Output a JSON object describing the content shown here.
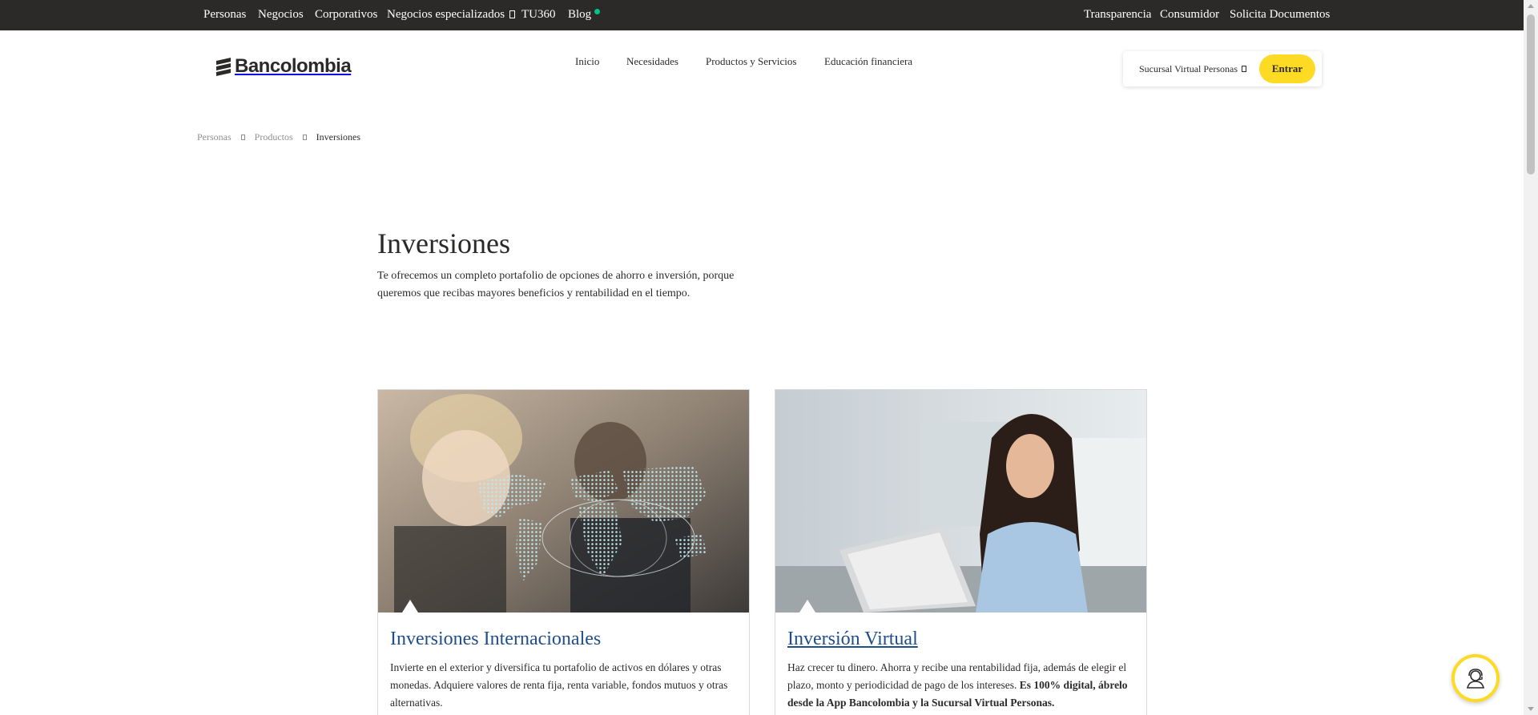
{
  "topbar": {
    "left_links": [
      "Personas",
      "Negocios",
      "Corporativos",
      "Negocios especializados",
      "TU360",
      "Blog"
    ],
    "right_links": [
      "Transparencia",
      "Consumidor",
      "Solicita Documentos"
    ]
  },
  "header": {
    "logo_text": "Bancolombia",
    "nav": [
      "Inicio",
      "Necesidades",
      "Productos y Servicios",
      "Educación financiera"
    ],
    "login_select": "Sucursal Virtual Personas",
    "login_button": "Entrar"
  },
  "breadcrumb": {
    "items": [
      "Personas",
      "Productos"
    ],
    "current": "Inversiones"
  },
  "hero": {
    "title": "Inversiones",
    "description": "Te ofrecemos un completo portafolio de opciones de ahorro e inversión, porque queremos que recibas mayores beneficios y rentabilidad en el tiempo."
  },
  "cards": [
    {
      "title": "Inversiones Internacionales",
      "text": "Invierte en el exterior y diversifica tu portafolio de activos en dólares y otras monedas. Adquiere valores de renta fija, renta variable, fondos mutuos  y otras alternativas."
    },
    {
      "title": "Inversión Virtual",
      "text": "Haz crecer tu dinero. Ahorra y recibe una rentabilidad fija, además de elegir el plazo, monto y periodicidad de pago de los intereses. ",
      "text_bold": "Es 100% digital, ábrelo desde la App Bancolombia y la Sucursal Virtual Personas."
    }
  ],
  "colors": {
    "topbar_bg": "#2c2a29",
    "accent_yellow": "#fdda24",
    "link_blue": "#1f4e8c",
    "blog_dot": "#00c389"
  },
  "icons": {
    "help": "agent-headset-icon",
    "breadcrumb_separator": "chevron-right-icon",
    "dropdown": "chevron-down-icon"
  }
}
